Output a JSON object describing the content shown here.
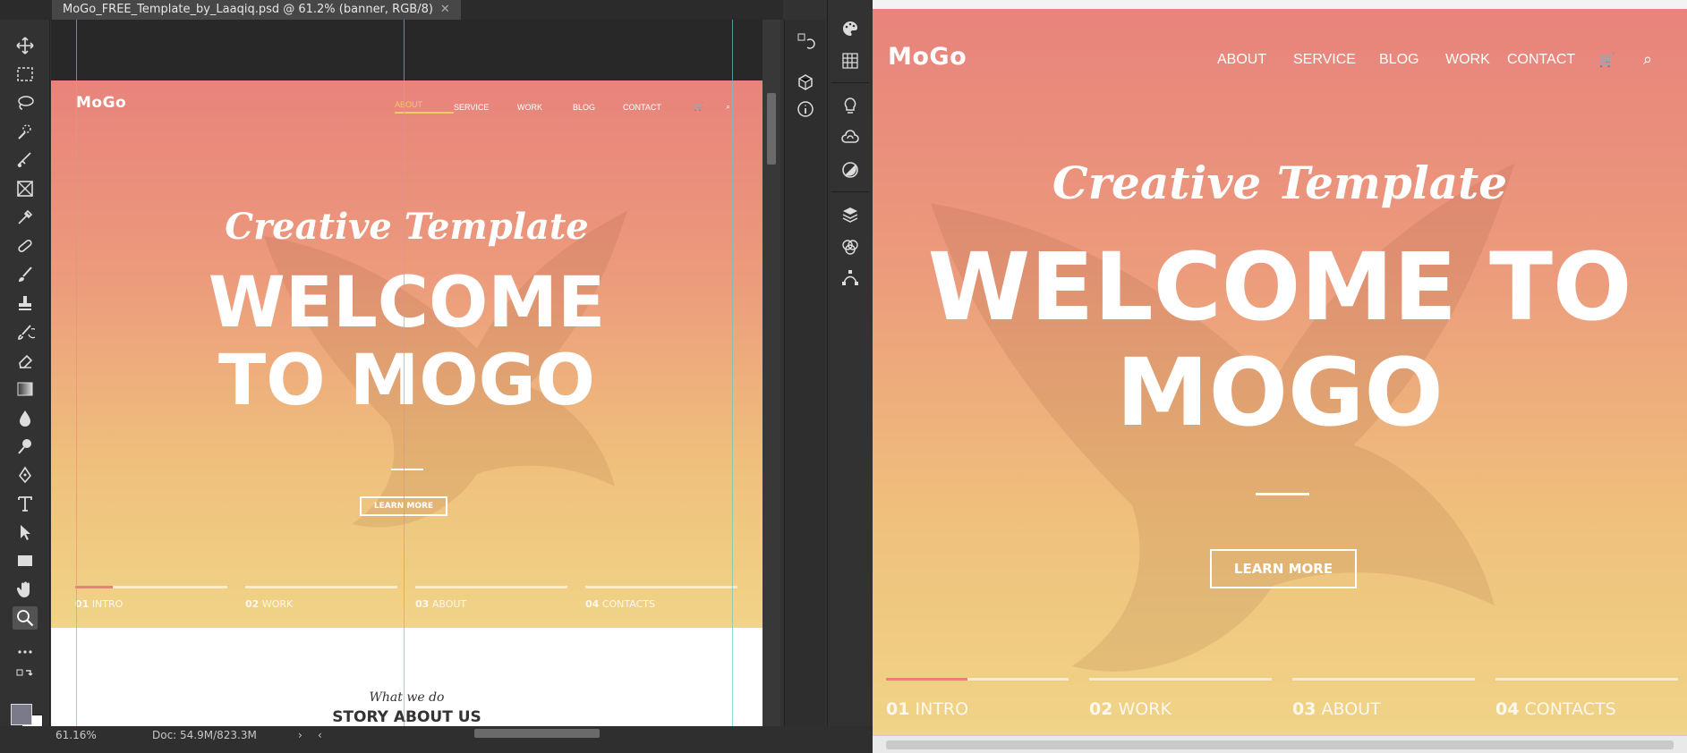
{
  "photoshop": {
    "document_tab": "MoGo_FREE_Template_by_Laaqiq.psd @ 61.2% (banner, RGB/8)",
    "zoom": "61.16%",
    "doc_info": "Doc: 54.9M/823.3M",
    "tools": [
      "move-tool",
      "marquee-tool",
      "lasso-tool",
      "quick-select-tool",
      "crop-tool",
      "frame-tool",
      "eyedropper-tool",
      "healing-tool",
      "brush-tool",
      "stamp-tool",
      "history-brush-tool",
      "eraser-tool",
      "gradient-tool",
      "blur-tool",
      "dodge-tool",
      "pen-tool",
      "type-tool",
      "path-select-tool",
      "rectangle-tool",
      "hand-tool",
      "zoom-tool",
      "more-tools"
    ],
    "active_tool": "zoom-tool",
    "foreground_color": "#7a7a8a",
    "background_color": "#ffffff"
  },
  "mockup": {
    "logo": "MoGo",
    "nav": [
      "ABOUT",
      "SERVICE",
      "WORK",
      "BLOG",
      "CONTACT"
    ],
    "script_title": "Creative Template",
    "welcome_line1": "WELCOME",
    "welcome_line2": "TO MOGO",
    "button": "LEARN MORE",
    "slides": [
      {
        "num": "01",
        "label": "INTRO"
      },
      {
        "num": "02",
        "label": "WORK"
      },
      {
        "num": "03",
        "label": "ABOUT"
      },
      {
        "num": "04",
        "label": "CONTACTS"
      }
    ],
    "what_we_do": "What we do",
    "story": "STORY ABOUT US"
  },
  "site": {
    "logo": "MoGo",
    "nav": [
      "ABOUT",
      "SERVICE",
      "BLOG",
      "WORK",
      "CONTACT"
    ],
    "script_title": "Creative Template",
    "welcome_line1": "WELCOME TO",
    "welcome_line2": "MOGO",
    "button": "LEARN MORE",
    "slides": [
      {
        "num": "01",
        "label": "INTRO"
      },
      {
        "num": "02",
        "label": "WORK"
      },
      {
        "num": "03",
        "label": "ABOUT"
      },
      {
        "num": "04",
        "label": "CONTACTS"
      }
    ]
  },
  "colors": {
    "accent": "#e8837c",
    "gradient_top": "#e8837c",
    "gradient_bottom": "#f0d487"
  }
}
